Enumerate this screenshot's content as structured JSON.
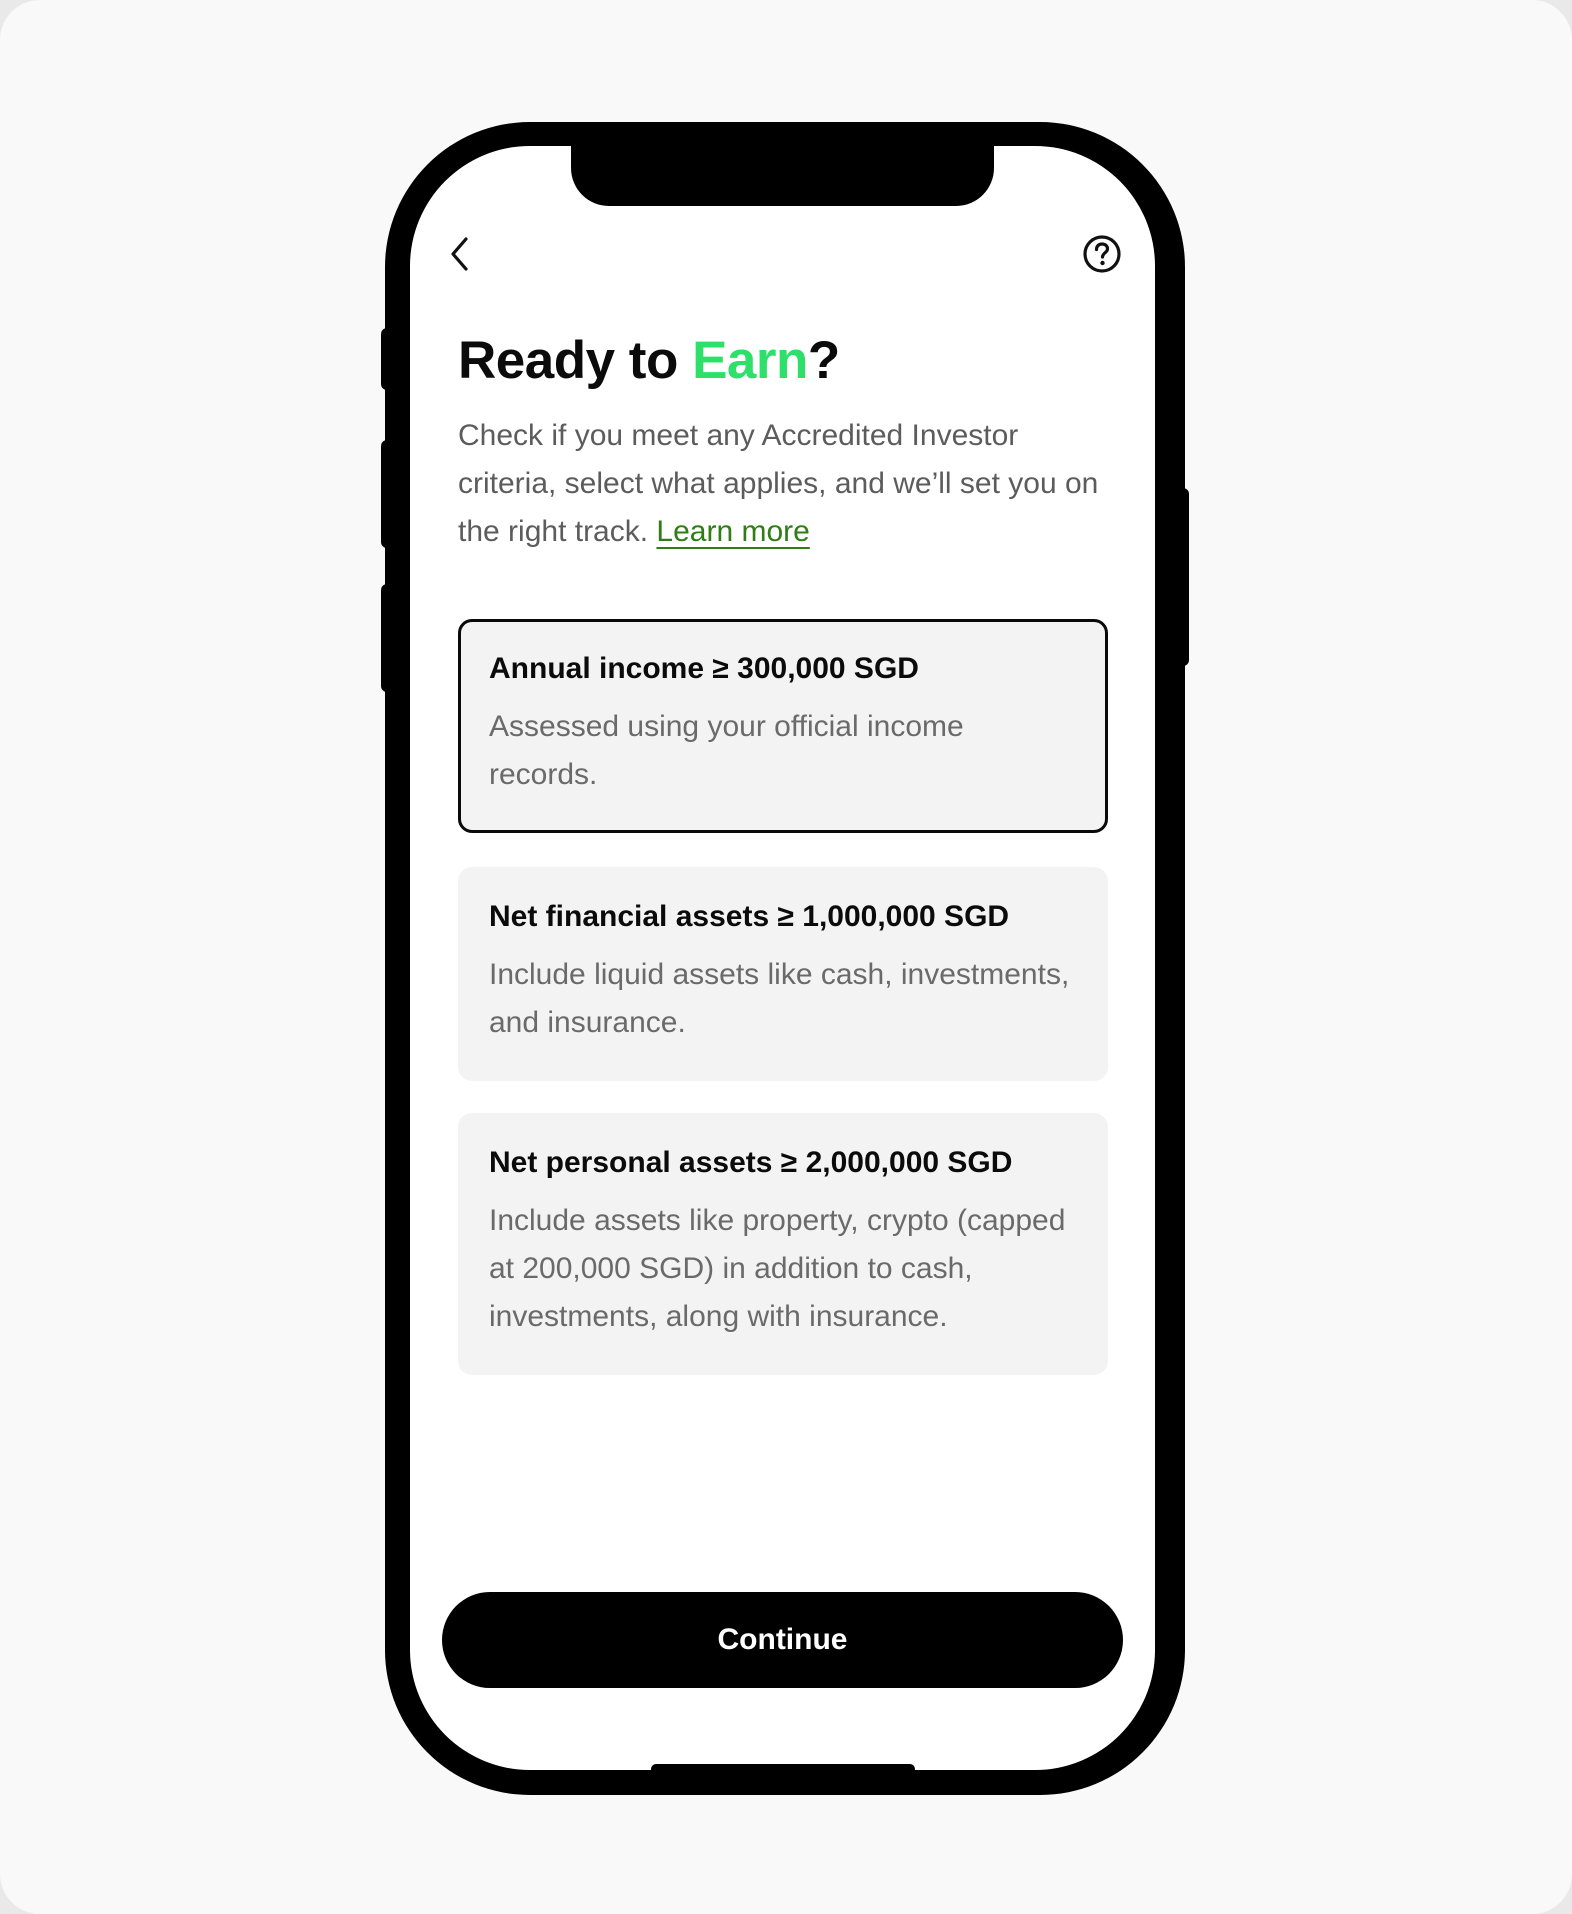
{
  "nav": {
    "back_icon": "chevron-left-icon",
    "help_icon": "question-circle-icon"
  },
  "header": {
    "title_prefix": "Ready to ",
    "title_accent": "Earn",
    "title_suffix": "?",
    "accent_color": "#2ee06a",
    "subtitle": "Check if you meet any Accredited Investor criteria, select what applies, and we’ll set you on the right track.",
    "learn_more": "Learn more",
    "link_color": "#2f7d14"
  },
  "options": [
    {
      "title": "Annual income ≥ 300,000 SGD",
      "description": "Assessed using your official income records.",
      "selected": true
    },
    {
      "title": "Net financial assets ≥ 1,000,000 SGD",
      "description": "Include liquid assets like cash, investments, and insurance.",
      "selected": false
    },
    {
      "title": "Net personal assets ≥ 2,000,000 SGD",
      "description": "Include assets like property, crypto (capped at 200,000 SGD) in addition to cash, investments, along with insurance.",
      "selected": false
    }
  ],
  "footer": {
    "continue_label": "Continue"
  }
}
